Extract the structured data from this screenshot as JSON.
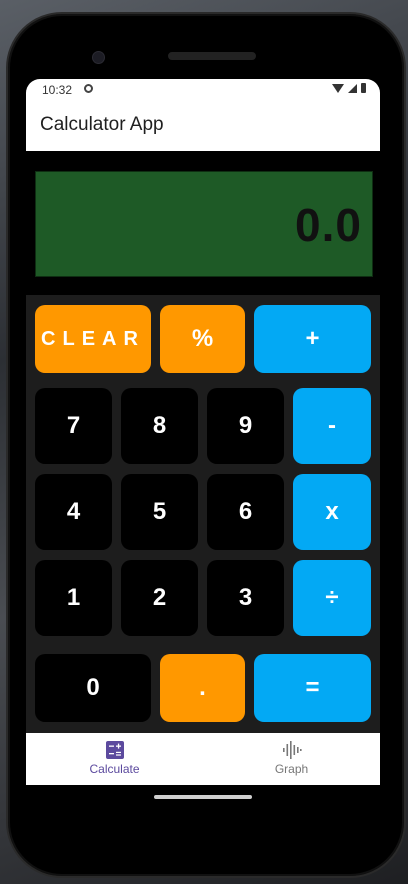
{
  "status": {
    "time": "10:32"
  },
  "app": {
    "title": "Calculator App"
  },
  "display": {
    "value": "0.0"
  },
  "keys": {
    "clear": "CLEAR",
    "percent": "%",
    "plus": "+",
    "seven": "7",
    "eight": "8",
    "nine": "9",
    "minus": "-",
    "four": "4",
    "five": "5",
    "six": "6",
    "multiply": "x",
    "one": "1",
    "two": "2",
    "three": "3",
    "divide": "÷",
    "zero": "0",
    "decimal": ".",
    "equals": "="
  },
  "nav": {
    "calculate": "Calculate",
    "graph": "Graph"
  },
  "colors": {
    "display_bg": "#1e5a26",
    "orange": "#ff9800",
    "blue": "#03a9f4",
    "nav_active": "#5c4a9e",
    "nav_inactive": "#777777"
  }
}
